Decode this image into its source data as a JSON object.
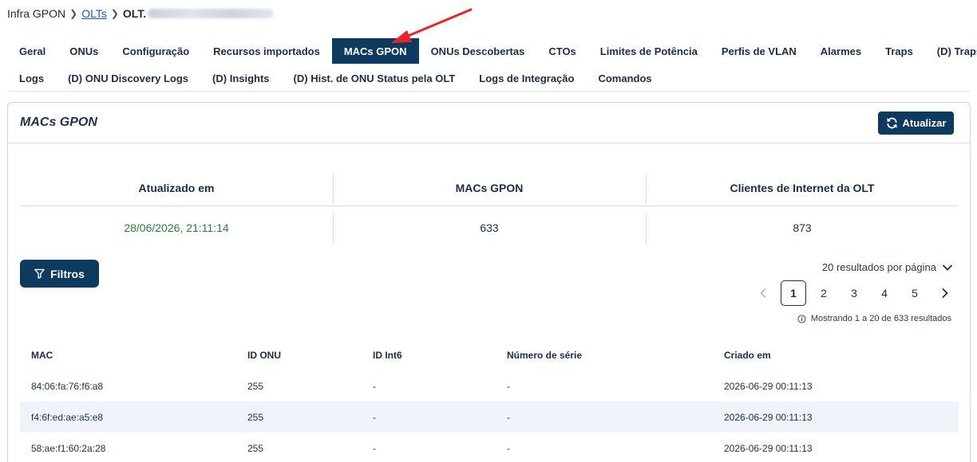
{
  "breadcrumb": {
    "root": "Infra GPON",
    "link": "OLTs",
    "current": "OLT."
  },
  "tabs_row1": [
    "Geral",
    "ONUs",
    "Configuração",
    "Recursos importados",
    "MACs GPON",
    "ONUs Descobertas",
    "CTOs",
    "Limites de Potência",
    "Perfis de VLAN",
    "Alarmes",
    "Traps",
    "(D) Traps Raw"
  ],
  "tabs_row2": [
    "Logs",
    "(D) ONU Discovery Logs",
    "(D) Insights",
    "(D) Hist. de ONU Status pela OLT",
    "Logs de Integração",
    "Comandos"
  ],
  "active_tab": "MACs GPON",
  "card": {
    "title": "MACs GPON",
    "refresh_label": "Atualizar"
  },
  "stats": {
    "headers": [
      "Atualizado em",
      "MACs GPON",
      "Clientes de Internet da OLT"
    ],
    "values": [
      "28/06/2026, 21:11:14",
      "633",
      "873"
    ]
  },
  "filter_label": "Filtros",
  "per_page_label": "20 resultados por página",
  "pagination": {
    "pages": [
      "1",
      "2",
      "3",
      "4",
      "5"
    ],
    "current": "1"
  },
  "showing_text": "Mostrando 1 a 20 de 633 resultados",
  "table": {
    "columns": [
      "MAC",
      "ID ONU",
      "ID Int6",
      "Número de série",
      "Criado em"
    ],
    "rows": [
      [
        "84:06:fa:76:f6:a8",
        "255",
        "-",
        "-",
        "2026-06-29 00:11:13"
      ],
      [
        "f4:6f:ed:ae:a5:e8",
        "255",
        "-",
        "-",
        "2026-06-29 00:11:13"
      ],
      [
        "58:ae:f1:60:2a:28",
        "255",
        "-",
        "-",
        "2026-06-29 00:11:13"
      ]
    ]
  },
  "colors": {
    "primary": "#0f3a5f",
    "link": "#1a56c7",
    "updated_value": "#2e7d44",
    "row_alt": "#eef4fa",
    "annotation_arrow": "#e3262b"
  },
  "icons": {
    "refresh": "refresh-icon",
    "filter": "filter-icon",
    "chevron_down": "chevron-down-icon",
    "info": "info-icon"
  }
}
